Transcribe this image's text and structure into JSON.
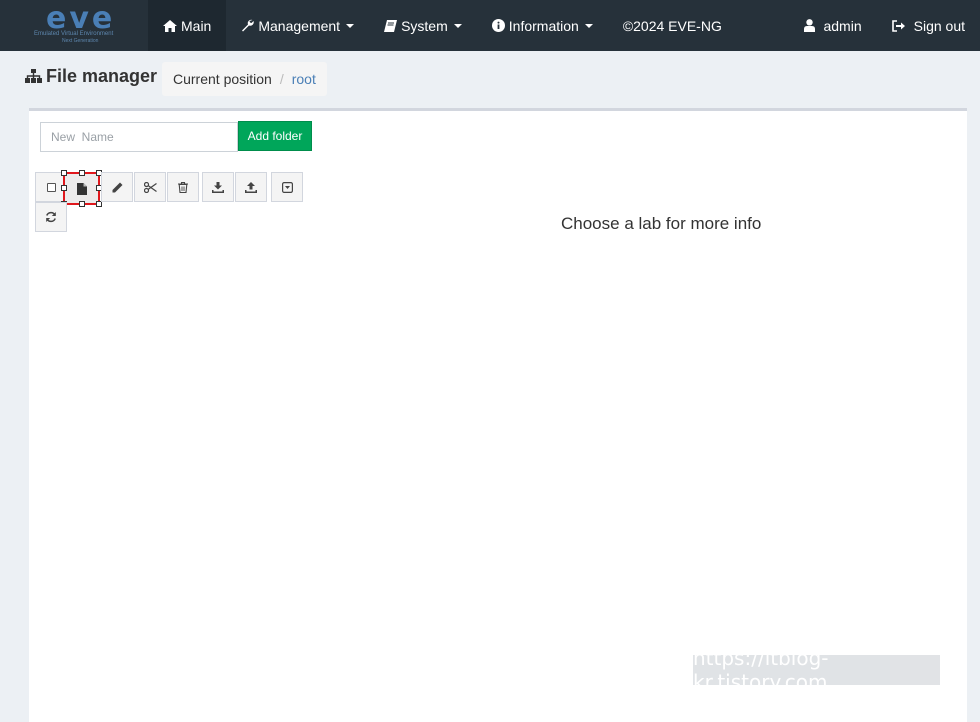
{
  "logo": {
    "word": "eve",
    "subtitle": "Emulated Virtual Environment",
    "subtitle2": "Next Generation"
  },
  "nav": {
    "main": "Main",
    "management": "Management",
    "system": "System",
    "information": "Information",
    "copyright": "©2024 EVE-NG",
    "user": "admin",
    "signout": "Sign out"
  },
  "page": {
    "title": "File manager",
    "breadcrumb_label": "Current position",
    "breadcrumb_separator": "/",
    "breadcrumb_current": "root"
  },
  "folder": {
    "placeholder": "New  Name",
    "add_label": "Add folder"
  },
  "info": {
    "message": "Choose a lab for more info"
  },
  "watermark": "https://itblog-kr.tistory.com",
  "colors": {
    "navbar": "#26313a",
    "accent": "#00a65a",
    "link": "#4a7fb6",
    "selection": "#e0171c"
  }
}
